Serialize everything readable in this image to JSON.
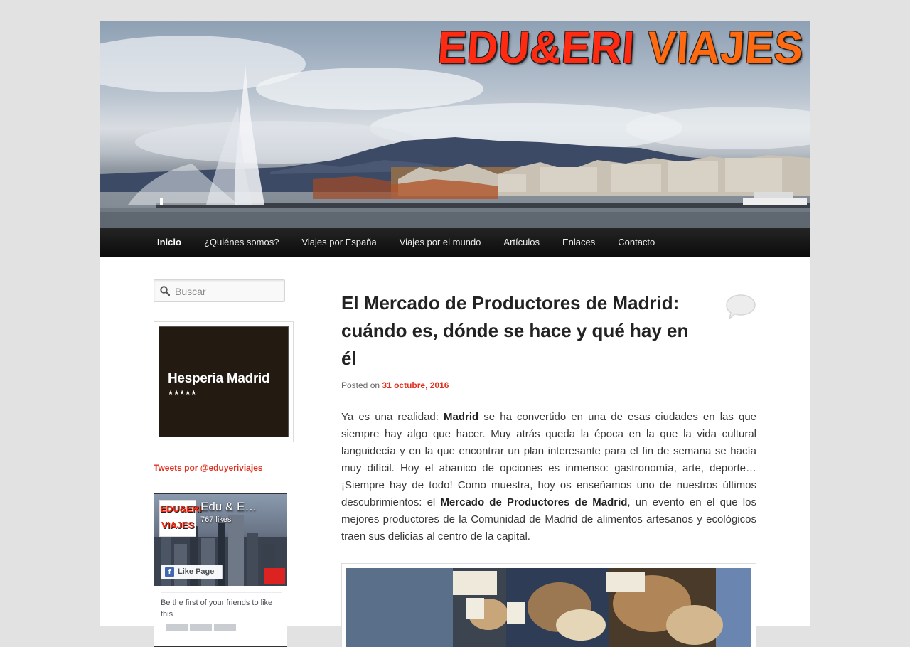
{
  "site": {
    "title_part1": "EDU&ERI",
    "title_part2": "VIAJES"
  },
  "nav": {
    "items": [
      {
        "label": "Inicio",
        "active": true
      },
      {
        "label": "¿Quiénes somos?",
        "active": false
      },
      {
        "label": "Viajes por España",
        "active": false
      },
      {
        "label": "Viajes por el mundo",
        "active": false
      },
      {
        "label": "Artículos",
        "active": false
      },
      {
        "label": "Enlaces",
        "active": false
      },
      {
        "label": "Contacto",
        "active": false
      }
    ]
  },
  "sidebar": {
    "search": {
      "placeholder": "Buscar",
      "value": ""
    },
    "hotel_ad": {
      "name": "Hesperia Madrid",
      "stars": "★★★★★"
    },
    "tweets_link": "Tweets por @eduyeriviajes",
    "facebook": {
      "logo_line1": "EDU&ERI",
      "logo_line2": "VIAJES",
      "page_name": "Edu & E…",
      "likes": "767 likes",
      "like_button": "Like Page",
      "friends_text": "Be the first of your friends to like this"
    }
  },
  "post": {
    "title": "El Mercado de Productores de Madrid: cuándo es, dónde se hace y qué hay en él",
    "meta_prefix": "Posted on",
    "date": "31 octubre, 2016",
    "body": {
      "t1": "Ya es una realidad: ",
      "b1": "Madrid",
      "t2": " se ha convertido en una de esas ciudades en las que siempre hay algo que hacer. Muy atrás queda la época en la que la vida cultural languidecía y en la que encontrar un plan interesante para el fin de semana se hacía muy difícil. Hoy el abanico de opciones es inmenso: gastronomía, arte, deporte… ¡Siempre hay de todo! Como muestra, hoy os enseñamos uno de nuestros últimos descubrimientos: el ",
      "b2": "Mercado de Productores de Madrid",
      "t3": ", un evento en el que los mejores productores de la Comunidad de Madrid de alimentos artesanos y ecológicos traen sus delicias al centro de la capital."
    }
  },
  "colors": {
    "accent": "#e0301e",
    "nav_bg": "#111111",
    "page_bg": "#e2e2e2",
    "title_red": "#ff2a12"
  }
}
